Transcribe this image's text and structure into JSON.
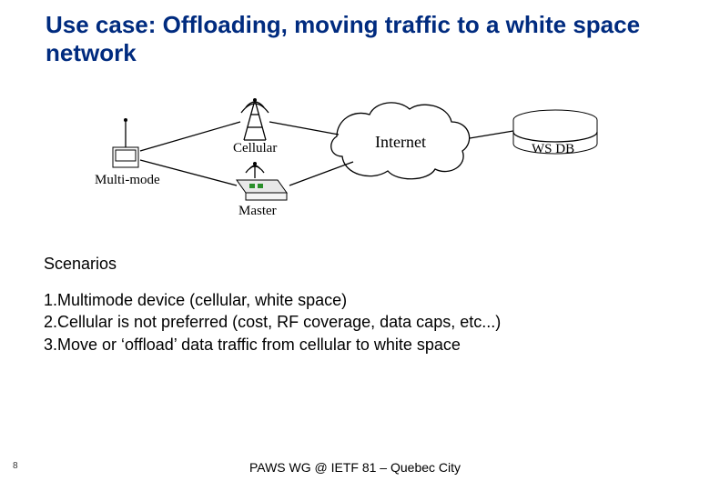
{
  "title": "Use case: Offloading, moving traffic to a white space network",
  "diagram": {
    "multimode": "Multi-mode",
    "cellular": "Cellular",
    "master": "Master",
    "internet": "Internet",
    "wsdb": "WS DB"
  },
  "scenarios": {
    "heading": "Scenarios",
    "item1": "1.Multimode device (cellular, white space)",
    "item2": "2.Cellular is not preferred (cost, RF coverage, data caps, etc...)",
    "item3": "3.Move or ‘offload’ data traffic from cellular to white space"
  },
  "footer": {
    "page": "8",
    "text": "PAWS WG @ IETF 81 – Quebec City"
  }
}
